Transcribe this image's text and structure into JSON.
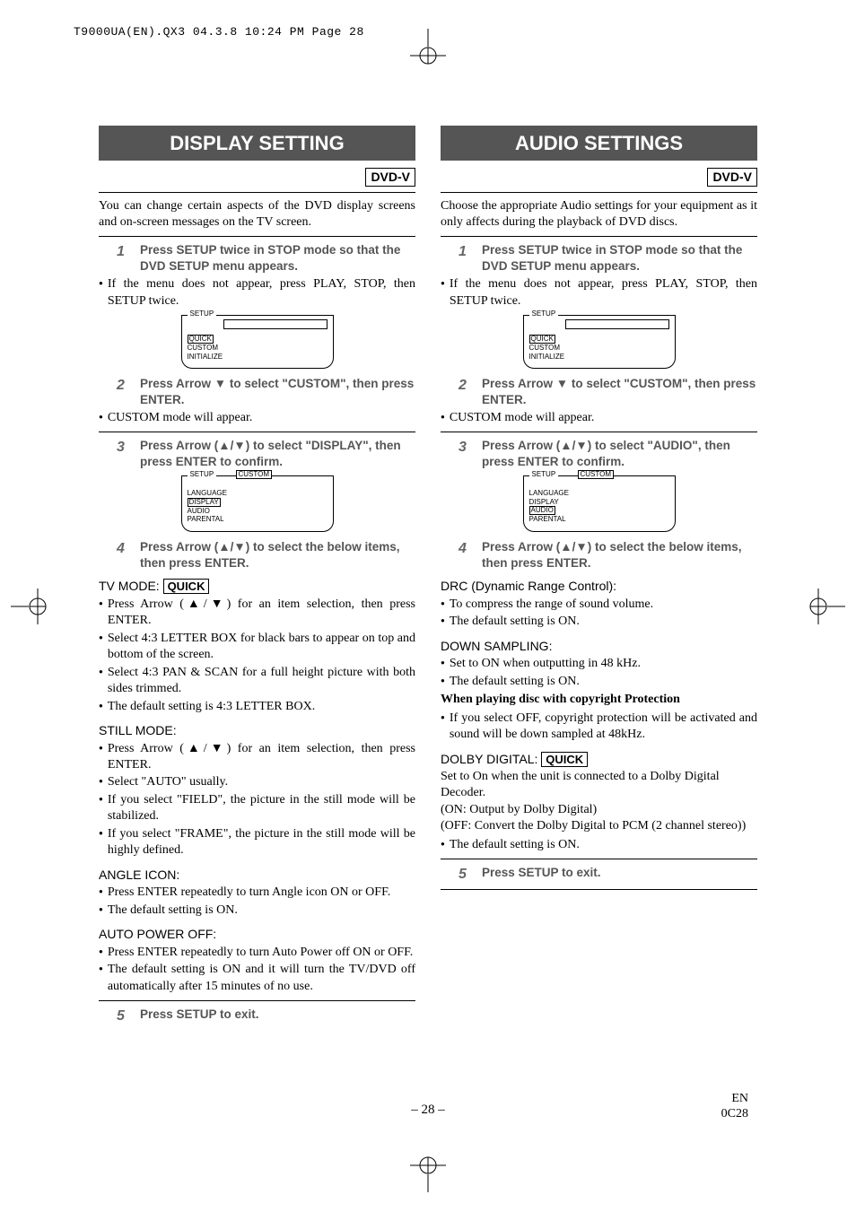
{
  "header": "T9000UA(EN).QX3  04.3.8  10:24 PM  Page 28",
  "left": {
    "title": "DISPLAY SETTING",
    "badge": "DVD-V",
    "intro": "You can change certain aspects of the DVD display screens and on-screen messages on the TV screen.",
    "step1": "Press SETUP twice in STOP mode so that the DVD SETUP menu appears.",
    "note1": "If the menu does not appear, press PLAY, STOP, then SETUP twice.",
    "menu1": {
      "tab": "SETUP",
      "hi": "QUICK",
      "items": [
        "CUSTOM",
        "INITIALIZE"
      ]
    },
    "step2": "Press Arrow ▼ to select \"CUSTOM\", then press ENTER.",
    "note2": "CUSTOM mode will appear.",
    "step3": "Press Arrow (▲/▼) to select \"DISPLAY\", then press ENTER to confirm.",
    "menu2": {
      "tab": "SETUP",
      "tab2": "CUSTOM",
      "items_pre": [
        "LANGUAGE"
      ],
      "hi": "DISPLAY",
      "items_post": [
        "AUDIO",
        "PARENTAL"
      ]
    },
    "step4": "Press Arrow (▲/▼) to select the below items, then press ENTER.",
    "tvmode_head": "TV MODE:",
    "quick": "QUICK",
    "tvmode_b1": "Press Arrow (▲/▼) for an item selection, then press ENTER.",
    "tvmode_b2": "Select 4:3 LETTER BOX for black bars to appear on top and bottom of the screen.",
    "tvmode_b3": "Select 4:3 PAN & SCAN for a full height picture with both sides trimmed.",
    "tvmode_b4": "The default setting is 4:3 LETTER BOX.",
    "still_head": "STILL MODE:",
    "still_b1": "Press Arrow (▲/▼) for an item selection, then press ENTER.",
    "still_b2": "Select \"AUTO\" usually.",
    "still_b3": "If you select \"FIELD\", the picture in the still mode will be stabilized.",
    "still_b4": "If you select \"FRAME\", the picture in the still mode will be highly defined.",
    "angle_head": "ANGLE ICON:",
    "angle_b1": "Press ENTER repeatedly to turn Angle icon ON or OFF.",
    "angle_b2": "The default setting is ON.",
    "apo_head": "AUTO POWER OFF:",
    "apo_b1": "Press ENTER repeatedly to turn Auto Power off ON or OFF.",
    "apo_b2": "The default setting is ON and it will turn the TV/DVD off automatically after 15 minutes of no use.",
    "step5": "Press SETUP to exit."
  },
  "right": {
    "title": "AUDIO SETTINGS",
    "badge": "DVD-V",
    "intro": "Choose the appropriate Audio settings for your equipment as it only affects during the playback of DVD discs.",
    "step1": "Press SETUP twice in STOP mode so that the DVD SETUP menu appears.",
    "note1": "If the menu does not appear, press PLAY, STOP, then SETUP twice.",
    "menu1": {
      "tab": "SETUP",
      "hi": "QUICK",
      "items": [
        "CUSTOM",
        "INITIALIZE"
      ]
    },
    "step2": "Press Arrow ▼ to select \"CUSTOM\", then press ENTER.",
    "note2": "CUSTOM mode will appear.",
    "step3": "Press Arrow (▲/▼) to select \"AUDIO\", then press ENTER to confirm.",
    "menu2": {
      "tab": "SETUP",
      "tab2": "CUSTOM",
      "items_pre": [
        "LANGUAGE",
        "DISPLAY"
      ],
      "hi": "AUDIO",
      "items_post": [
        "PARENTAL"
      ]
    },
    "step4": "Press Arrow (▲/▼) to select the below items, then press ENTER.",
    "drc_head": "DRC (Dynamic Range Control):",
    "drc_b1": "To compress the range of sound volume.",
    "drc_b2": "The default setting is ON.",
    "ds_head": "DOWN SAMPLING:",
    "ds_b1": "Set to ON when outputting in 48 kHz.",
    "ds_b2": "The default setting is ON.",
    "copy_head": "When playing disc with copyright Protection",
    "copy_b1": "If you select OFF, copyright protection will be activated and sound will be down sampled at 48kHz.",
    "dolby_head": "DOLBY DIGITAL:",
    "dolby_p1": "Set to On when the unit is connected to a Dolby Digital Decoder.",
    "dolby_p2": "(ON: Output by Dolby Digital)",
    "dolby_p3": "(OFF: Convert the Dolby Digital to PCM (2 channel stereo))",
    "dolby_b1": "The default setting is ON.",
    "step5": "Press SETUP to exit."
  },
  "footer": {
    "page": "– 28 –",
    "en": "EN",
    "code": "0C28"
  }
}
